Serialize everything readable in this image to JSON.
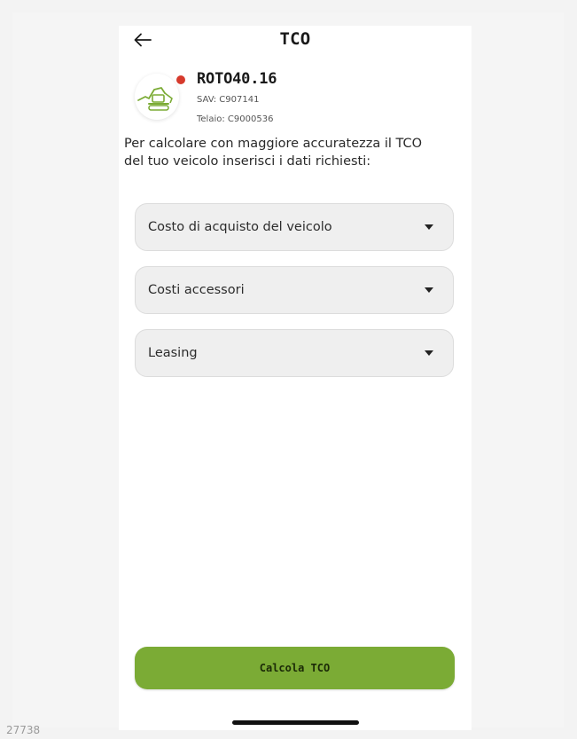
{
  "header": {
    "back_icon": "arrow-left-icon",
    "title": "TCO"
  },
  "vehicle": {
    "logo_icon": "excavator-icon",
    "status_color": "#d63a2c",
    "model": "ROTO40.16",
    "sav": "SAV: C907141",
    "telaio": "Telaio: C9000536"
  },
  "intro": {
    "line1": "Per calcolare con maggiore accuratezza il TCO",
    "line2": "del tuo veicolo inserisci i dati richiesti:"
  },
  "dropdowns": [
    {
      "label": "Costo di acquisto del veicolo",
      "icon": "caret-down-icon"
    },
    {
      "label": "Costi accessori",
      "icon": "caret-down-icon"
    },
    {
      "label": "Leasing",
      "icon": "caret-down-icon"
    }
  ],
  "action": {
    "calc_label": "Calcola TCO",
    "accent_color": "#7bab35"
  },
  "footer": {
    "corner_id": "27738"
  }
}
